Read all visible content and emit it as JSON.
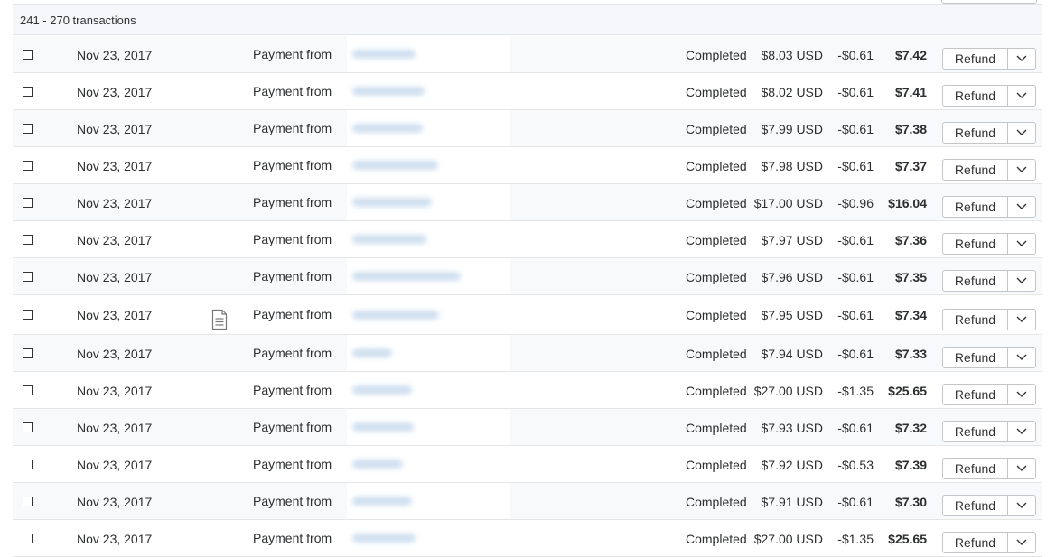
{
  "summary": {
    "range_label": "241 - 270 transactions"
  },
  "row_labels": {
    "refund_label": "Refund"
  },
  "transactions": [
    {
      "date": "Nov 23, 2017",
      "description": "Payment from",
      "status": "Completed",
      "gross": "$8.03 USD",
      "fee": "-$0.61",
      "net": "$7.42"
    },
    {
      "date": "Nov 23, 2017",
      "description": "Payment from",
      "status": "Completed",
      "gross": "$8.02 USD",
      "fee": "-$0.61",
      "net": "$7.41"
    },
    {
      "date": "Nov 23, 2017",
      "description": "Payment from",
      "status": "Completed",
      "gross": "$7.99 USD",
      "fee": "-$0.61",
      "net": "$7.38"
    },
    {
      "date": "Nov 23, 2017",
      "description": "Payment from",
      "status": "Completed",
      "gross": "$7.98 USD",
      "fee": "-$0.61",
      "net": "$7.37"
    },
    {
      "date": "Nov 23, 2017",
      "description": "Payment from",
      "status": "Completed",
      "gross": "$17.00 USD",
      "fee": "-$0.96",
      "net": "$16.04"
    },
    {
      "date": "Nov 23, 2017",
      "description": "Payment from",
      "status": "Completed",
      "gross": "$7.97 USD",
      "fee": "-$0.61",
      "net": "$7.36"
    },
    {
      "date": "Nov 23, 2017",
      "description": "Payment from",
      "status": "Completed",
      "gross": "$7.96 USD",
      "fee": "-$0.61",
      "net": "$7.35"
    },
    {
      "date": "Nov 23, 2017",
      "description": "Payment from",
      "status": "Completed",
      "gross": "$7.95 USD",
      "fee": "-$0.61",
      "net": "$7.34",
      "has_note": true,
      "note_icon": "note-document-icon"
    },
    {
      "date": "Nov 23, 2017",
      "description": "Payment from",
      "status": "Completed",
      "gross": "$7.94 USD",
      "fee": "-$0.61",
      "net": "$7.33"
    },
    {
      "date": "Nov 23, 2017",
      "description": "Payment from",
      "status": "Completed",
      "gross": "$27.00 USD",
      "fee": "-$1.35",
      "net": "$25.65"
    },
    {
      "date": "Nov 23, 2017",
      "description": "Payment from",
      "status": "Completed",
      "gross": "$7.93 USD",
      "fee": "-$0.61",
      "net": "$7.32"
    },
    {
      "date": "Nov 23, 2017",
      "description": "Payment from",
      "status": "Completed",
      "gross": "$7.92 USD",
      "fee": "-$0.53",
      "net": "$7.39"
    },
    {
      "date": "Nov 23, 2017",
      "description": "Payment from",
      "status": "Completed",
      "gross": "$7.91 USD",
      "fee": "-$0.61",
      "net": "$7.30"
    },
    {
      "date": "Nov 23, 2017",
      "description": "Payment from",
      "status": "Completed",
      "gross": "$27.00 USD",
      "fee": "-$1.35",
      "net": "$25.65"
    }
  ],
  "icons": {
    "checkbox": "checkbox-icon",
    "caret": "chevron-down-icon",
    "note": "note-document-icon"
  },
  "colors": {
    "row_alt_bg": "#f8f9fb",
    "summary_bg": "#f5f7fa",
    "redaction": "#cfdff0",
    "border": "#e6e6e6"
  }
}
